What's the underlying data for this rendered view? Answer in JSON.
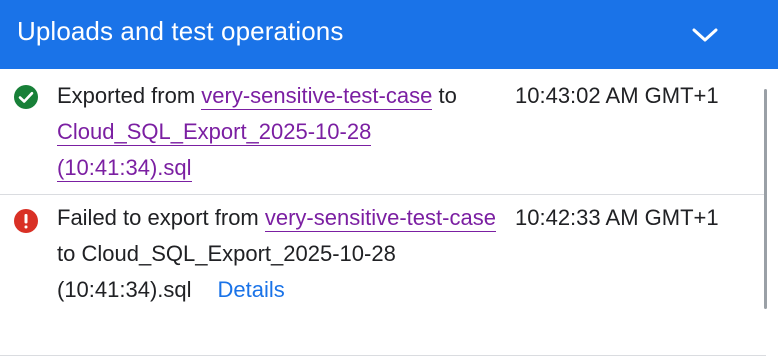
{
  "header": {
    "title": "Uploads and test operations",
    "collapse_icon": "chevron-down-icon",
    "background": "#1a73e8"
  },
  "operations": [
    {
      "status": "success",
      "status_icon": "check-circle-icon",
      "status_color": "#188038",
      "prefix": "Exported from ",
      "source_link": "very-sensitive-test-case",
      "middle": "to",
      "target_link": "Cloud_SQL_Export_2025-10-28 (10:41:34).sql",
      "time": "10:43:02 AM GMT+1"
    },
    {
      "status": "error",
      "status_icon": "error-icon",
      "status_color": "#d93025",
      "prefix": "Failed to export from ",
      "source_link": "very-sensitive-test-case",
      "middle": "to",
      "target_text": "Cloud_SQL_Export_2025-10-28 (10:41:34).sql",
      "details_label": "Details",
      "time": "10:42:33 AM GMT+1"
    }
  ],
  "colors": {
    "visited_link": "#7b1fa2",
    "details_link": "#1a73e8",
    "text": "#202124",
    "divider": "#dadce0"
  }
}
